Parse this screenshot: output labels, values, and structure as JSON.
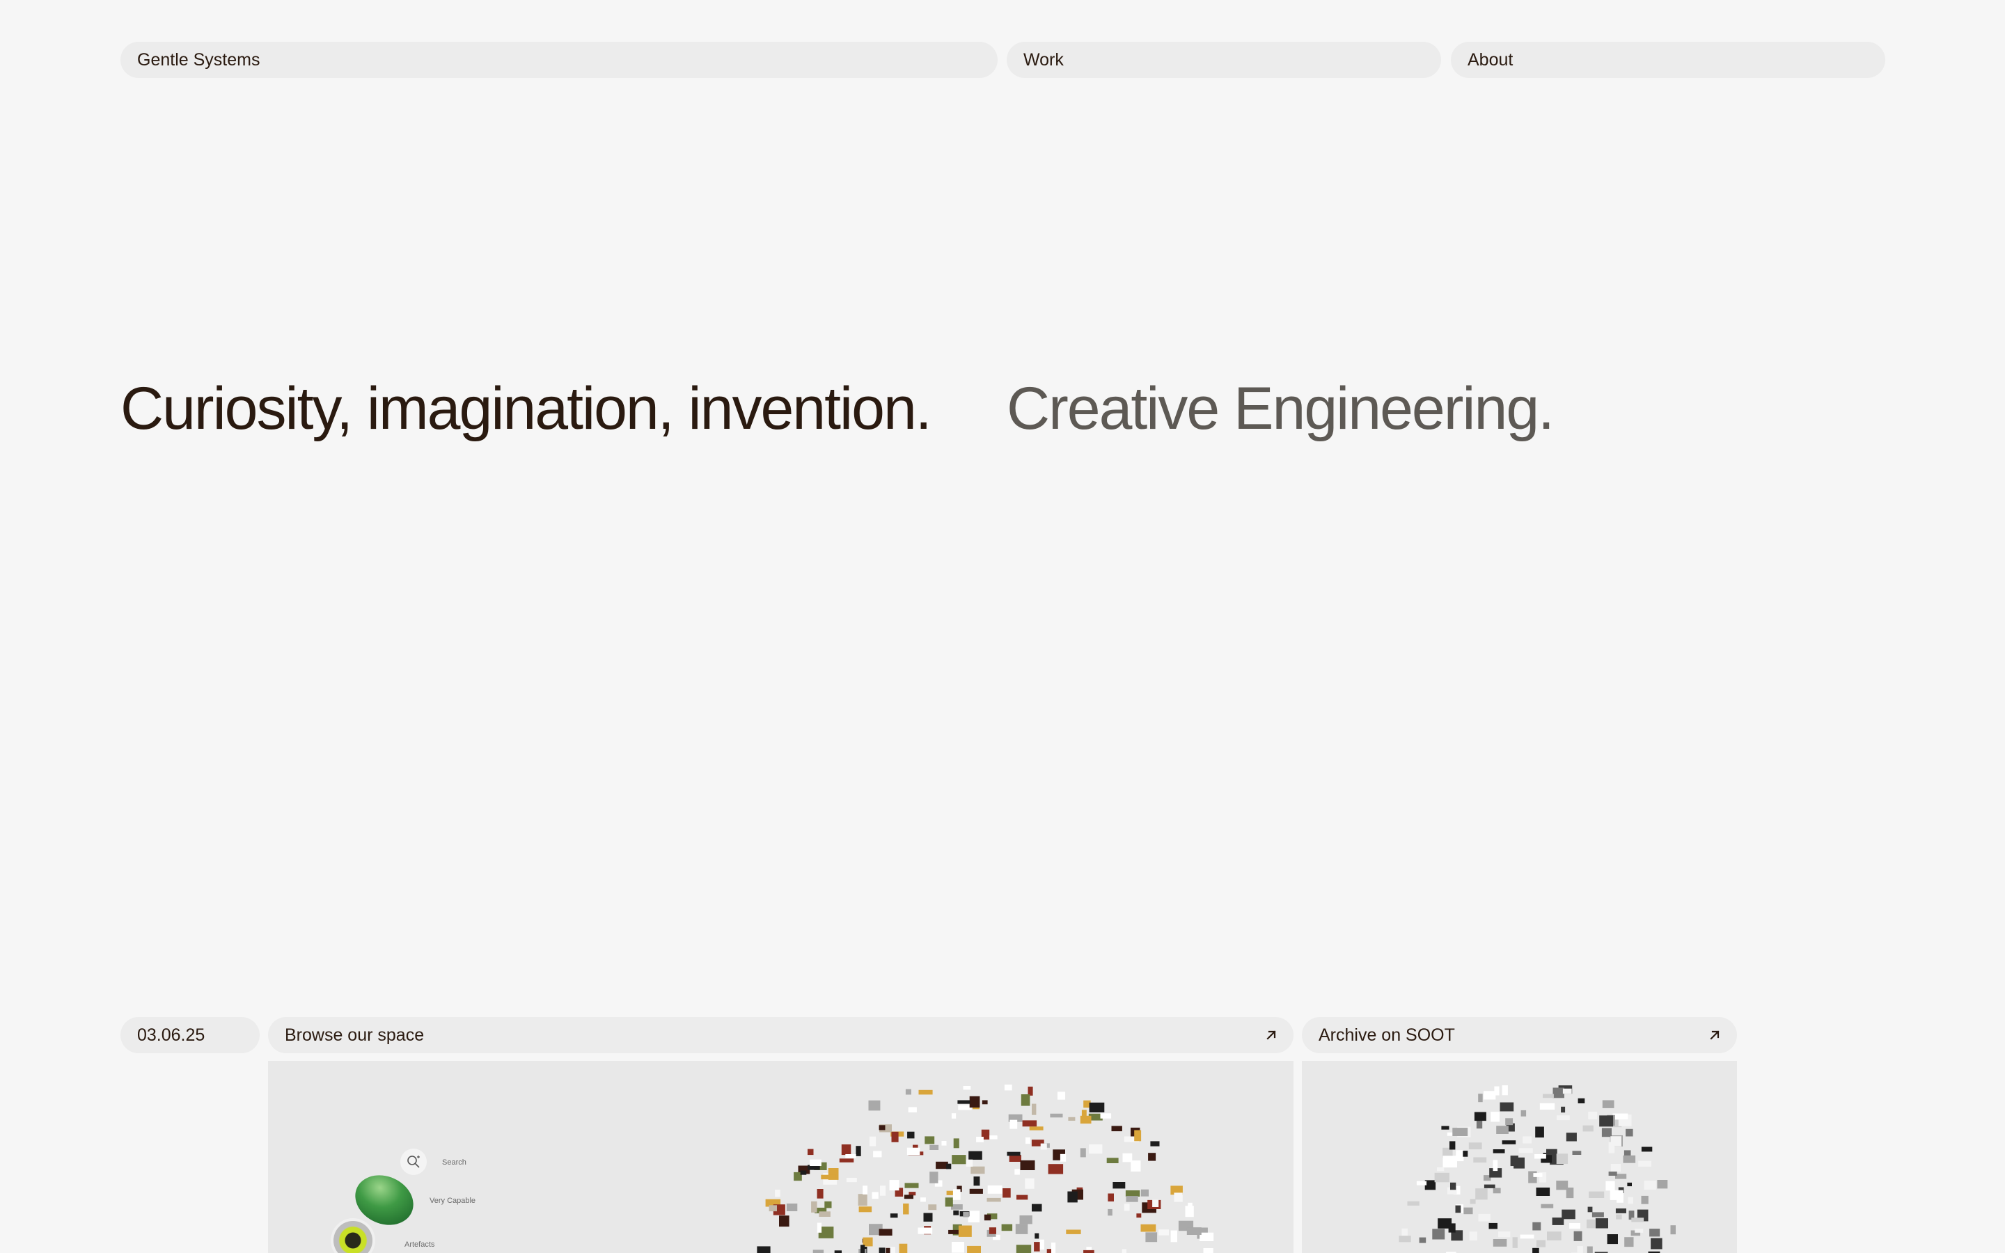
{
  "nav": {
    "brand": "Gentle Systems",
    "work": "Work",
    "about": "About"
  },
  "hero": {
    "primary": "Curiosity, imagination, invention.",
    "secondary": "Creative Engineering."
  },
  "bottom": {
    "date": "03.06.25",
    "browse_label": "Browse our space",
    "archive_label": "Archive on SOOT"
  },
  "browse_preview": {
    "menu": {
      "search": "Search",
      "very_capable": "Very Capable",
      "artefacts": "Artefacts"
    }
  },
  "icons": {
    "browse_arrow": "arrow-up-right-icon",
    "archive_arrow": "arrow-up-right-icon",
    "search": "search-icon"
  },
  "colors": {
    "background": "#f6f6f6",
    "pill": "#ececec",
    "text": "#2a1a10",
    "text_muted": "#5d5954",
    "preview": "#e8e8e8"
  }
}
